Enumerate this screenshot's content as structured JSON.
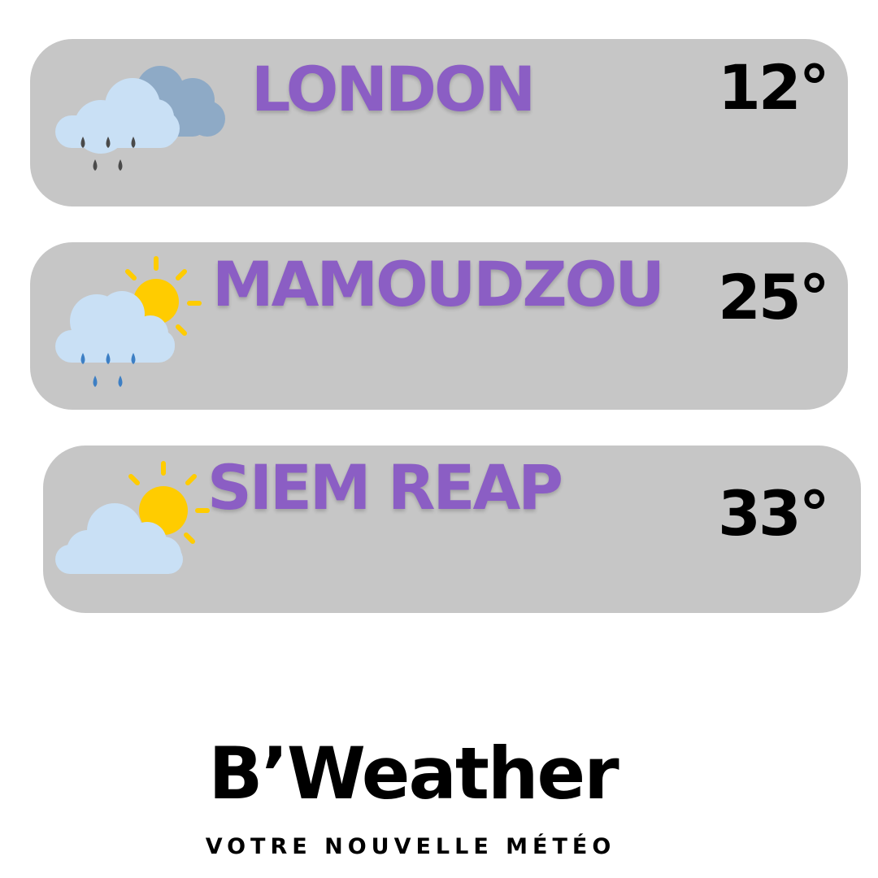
{
  "colors": {
    "card_bg": "#c6c6c6",
    "city_text": "#8b5ec4",
    "temp_text": "#000000",
    "cloud_light": "#c9e0f5",
    "cloud_dark": "#8eaac6",
    "sun": "#ffcc00",
    "rain_dark": "#4a4a4a",
    "rain_blue": "#3d7fc4"
  },
  "cities": [
    {
      "name": "LONDON",
      "temp": "12°",
      "icon": "rain-cloud-icon"
    },
    {
      "name": "MAMOUDZOU",
      "temp": "25°",
      "icon": "sun-rain-cloud-icon"
    },
    {
      "name": "SIEM REAP",
      "temp": "33°",
      "icon": "partly-cloudy-icon"
    }
  ],
  "brand": {
    "name": "B’Weather",
    "tagline": "VOTRE NOUVELLE MÉTÉO"
  }
}
